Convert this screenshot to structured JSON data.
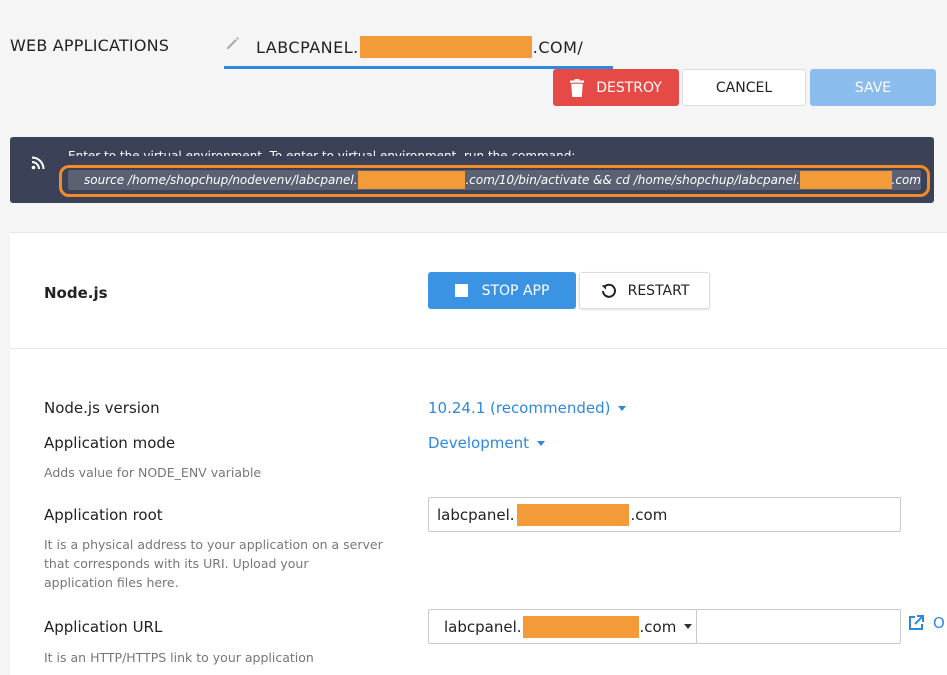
{
  "header": {
    "title": "WEB APPLICATIONS",
    "domain_prefix": "LABCPANEL.",
    "domain_suffix": ".COM/",
    "edit_icon": "pencil-icon"
  },
  "toolbar": {
    "destroy_label": "DESTROY",
    "cancel_label": "CANCEL",
    "save_label": "SAVE",
    "destroy_icon": "trash-icon"
  },
  "notice": {
    "icon": "rss-icon",
    "text": "Enter to the virtual environment. To enter to virtual environment, run the command:",
    "command_part1": "source /home/shopchup/nodevenv/labcpanel.",
    "command_part2": ".com/10/bin/activate && cd /home/shopchup/labcpanel.",
    "command_part3": ".com"
  },
  "app": {
    "title": "Node.js",
    "stop_label": "STOP APP",
    "restart_label": "RESTART",
    "restart_icon": "restart-icon",
    "stop_icon": "stop-square-icon"
  },
  "fields": {
    "version": {
      "label": "Node.js version",
      "value": "10.24.1 (recommended)"
    },
    "mode": {
      "label": "Application mode",
      "value": "Development",
      "hint": "Adds value for NODE_ENV variable"
    },
    "root": {
      "label": "Application root",
      "value_prefix": "labcpanel.",
      "value_suffix": ".com",
      "hint_line1": "It is a physical address to your application on a server",
      "hint_line2": "that corresponds with its URI. Upload your",
      "hint_line3": "application files here."
    },
    "url": {
      "label": "Application URL",
      "domain_prefix": "labcpanel.",
      "domain_suffix": ".com",
      "path_value": "",
      "hint": "It is an HTTP/HTTPS link to your application",
      "open_icon": "external-link-icon",
      "open_label": "O"
    }
  },
  "colors": {
    "accent": "#2f88df",
    "destroy": "#e54a47",
    "save": "#8bbcee",
    "notice_bg": "#3b4157",
    "redaction": "#f29b38",
    "highlight": "#f28c28"
  }
}
